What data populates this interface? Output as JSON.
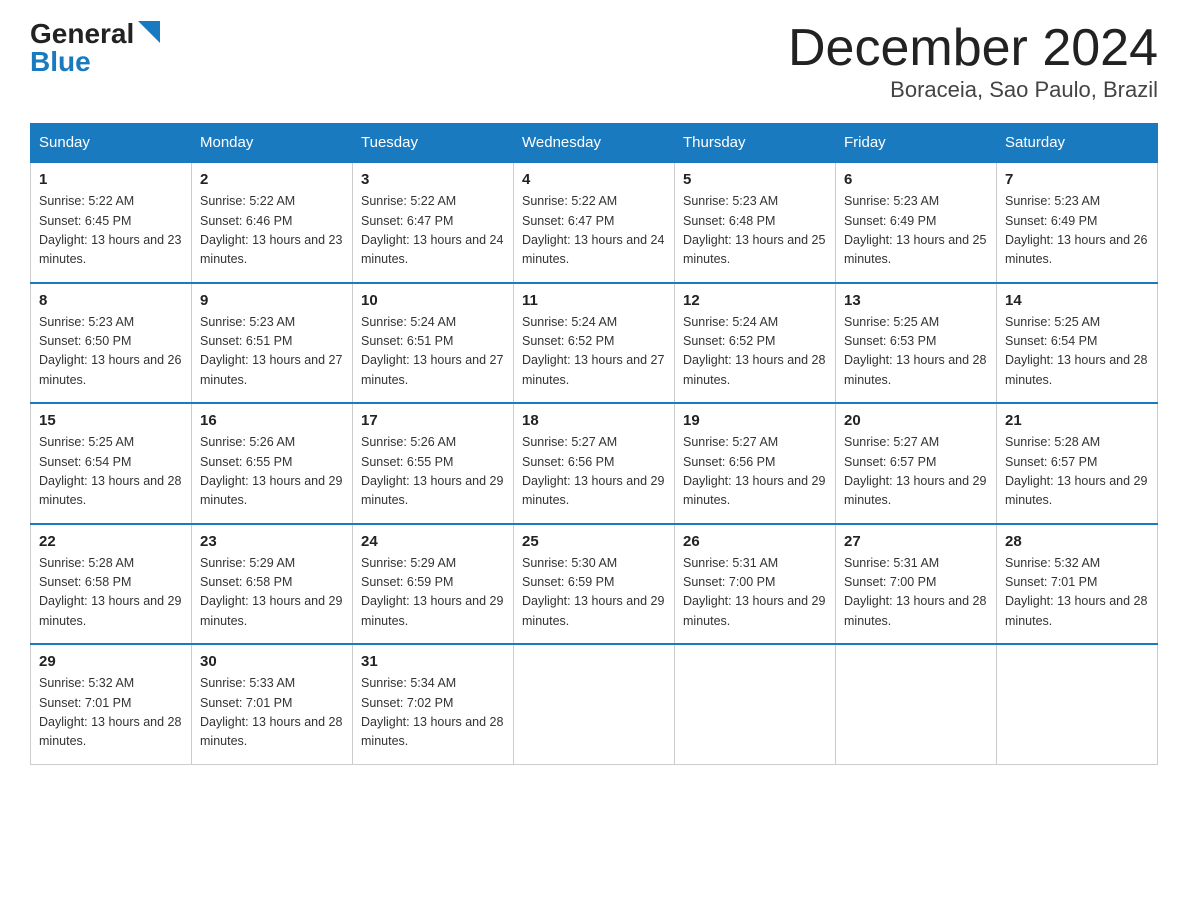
{
  "logo": {
    "general": "General",
    "blue": "Blue"
  },
  "title": "December 2024",
  "subtitle": "Boraceia, Sao Paulo, Brazil",
  "headers": [
    "Sunday",
    "Monday",
    "Tuesday",
    "Wednesday",
    "Thursday",
    "Friday",
    "Saturday"
  ],
  "weeks": [
    [
      {
        "day": "1",
        "sunrise": "5:22 AM",
        "sunset": "6:45 PM",
        "daylight": "13 hours and 23 minutes."
      },
      {
        "day": "2",
        "sunrise": "5:22 AM",
        "sunset": "6:46 PM",
        "daylight": "13 hours and 23 minutes."
      },
      {
        "day": "3",
        "sunrise": "5:22 AM",
        "sunset": "6:47 PM",
        "daylight": "13 hours and 24 minutes."
      },
      {
        "day": "4",
        "sunrise": "5:22 AM",
        "sunset": "6:47 PM",
        "daylight": "13 hours and 24 minutes."
      },
      {
        "day": "5",
        "sunrise": "5:23 AM",
        "sunset": "6:48 PM",
        "daylight": "13 hours and 25 minutes."
      },
      {
        "day": "6",
        "sunrise": "5:23 AM",
        "sunset": "6:49 PM",
        "daylight": "13 hours and 25 minutes."
      },
      {
        "day": "7",
        "sunrise": "5:23 AM",
        "sunset": "6:49 PM",
        "daylight": "13 hours and 26 minutes."
      }
    ],
    [
      {
        "day": "8",
        "sunrise": "5:23 AM",
        "sunset": "6:50 PM",
        "daylight": "13 hours and 26 minutes."
      },
      {
        "day": "9",
        "sunrise": "5:23 AM",
        "sunset": "6:51 PM",
        "daylight": "13 hours and 27 minutes."
      },
      {
        "day": "10",
        "sunrise": "5:24 AM",
        "sunset": "6:51 PM",
        "daylight": "13 hours and 27 minutes."
      },
      {
        "day": "11",
        "sunrise": "5:24 AM",
        "sunset": "6:52 PM",
        "daylight": "13 hours and 27 minutes."
      },
      {
        "day": "12",
        "sunrise": "5:24 AM",
        "sunset": "6:52 PM",
        "daylight": "13 hours and 28 minutes."
      },
      {
        "day": "13",
        "sunrise": "5:25 AM",
        "sunset": "6:53 PM",
        "daylight": "13 hours and 28 minutes."
      },
      {
        "day": "14",
        "sunrise": "5:25 AM",
        "sunset": "6:54 PM",
        "daylight": "13 hours and 28 minutes."
      }
    ],
    [
      {
        "day": "15",
        "sunrise": "5:25 AM",
        "sunset": "6:54 PM",
        "daylight": "13 hours and 28 minutes."
      },
      {
        "day": "16",
        "sunrise": "5:26 AM",
        "sunset": "6:55 PM",
        "daylight": "13 hours and 29 minutes."
      },
      {
        "day": "17",
        "sunrise": "5:26 AM",
        "sunset": "6:55 PM",
        "daylight": "13 hours and 29 minutes."
      },
      {
        "day": "18",
        "sunrise": "5:27 AM",
        "sunset": "6:56 PM",
        "daylight": "13 hours and 29 minutes."
      },
      {
        "day": "19",
        "sunrise": "5:27 AM",
        "sunset": "6:56 PM",
        "daylight": "13 hours and 29 minutes."
      },
      {
        "day": "20",
        "sunrise": "5:27 AM",
        "sunset": "6:57 PM",
        "daylight": "13 hours and 29 minutes."
      },
      {
        "day": "21",
        "sunrise": "5:28 AM",
        "sunset": "6:57 PM",
        "daylight": "13 hours and 29 minutes."
      }
    ],
    [
      {
        "day": "22",
        "sunrise": "5:28 AM",
        "sunset": "6:58 PM",
        "daylight": "13 hours and 29 minutes."
      },
      {
        "day": "23",
        "sunrise": "5:29 AM",
        "sunset": "6:58 PM",
        "daylight": "13 hours and 29 minutes."
      },
      {
        "day": "24",
        "sunrise": "5:29 AM",
        "sunset": "6:59 PM",
        "daylight": "13 hours and 29 minutes."
      },
      {
        "day": "25",
        "sunrise": "5:30 AM",
        "sunset": "6:59 PM",
        "daylight": "13 hours and 29 minutes."
      },
      {
        "day": "26",
        "sunrise": "5:31 AM",
        "sunset": "7:00 PM",
        "daylight": "13 hours and 29 minutes."
      },
      {
        "day": "27",
        "sunrise": "5:31 AM",
        "sunset": "7:00 PM",
        "daylight": "13 hours and 28 minutes."
      },
      {
        "day": "28",
        "sunrise": "5:32 AM",
        "sunset": "7:01 PM",
        "daylight": "13 hours and 28 minutes."
      }
    ],
    [
      {
        "day": "29",
        "sunrise": "5:32 AM",
        "sunset": "7:01 PM",
        "daylight": "13 hours and 28 minutes."
      },
      {
        "day": "30",
        "sunrise": "5:33 AM",
        "sunset": "7:01 PM",
        "daylight": "13 hours and 28 minutes."
      },
      {
        "day": "31",
        "sunrise": "5:34 AM",
        "sunset": "7:02 PM",
        "daylight": "13 hours and 28 minutes."
      },
      null,
      null,
      null,
      null
    ]
  ]
}
